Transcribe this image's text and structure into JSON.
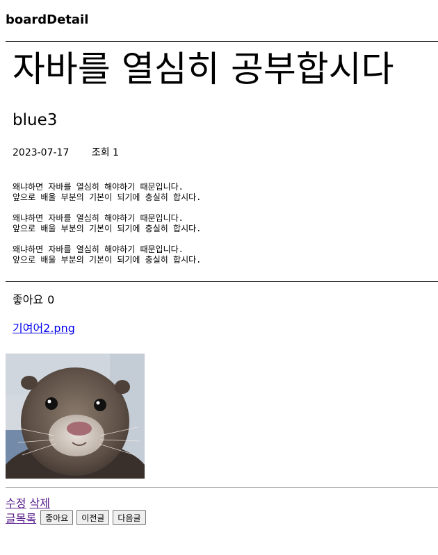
{
  "page": {
    "title": "boardDetail"
  },
  "post": {
    "title": "자바를 열심히 공부합시다",
    "author": "blue3",
    "date": "2023-07-17",
    "views_label": "조회",
    "views": "1",
    "content": [
      "왜냐하면 자바를 열심히 해야하기 때문입니다.\n앞으로 배울 부분의 기본이 되기에 충실히 합시다.",
      "왜냐하면 자바를 열심히 해야하기 때문입니다.\n앞으로 배울 부분의 기본이 되기에 충실히 합시다.",
      "왜냐하면 자바를 열심히 해야하기 때문입니다.\n앞으로 배울 부분의 기본이 되기에 충실히 합시다."
    ],
    "likes_label": "좋아요",
    "likes": "0",
    "attachment": "기여어2.png"
  },
  "actions": {
    "edit": "수정",
    "delete": "삭제",
    "list": "글목록",
    "like_button": "좋아요",
    "prev_button": "이전글",
    "next_button": "다음글"
  },
  "colors": {
    "visited_link": "#551a8b",
    "link": "#0000ee"
  }
}
